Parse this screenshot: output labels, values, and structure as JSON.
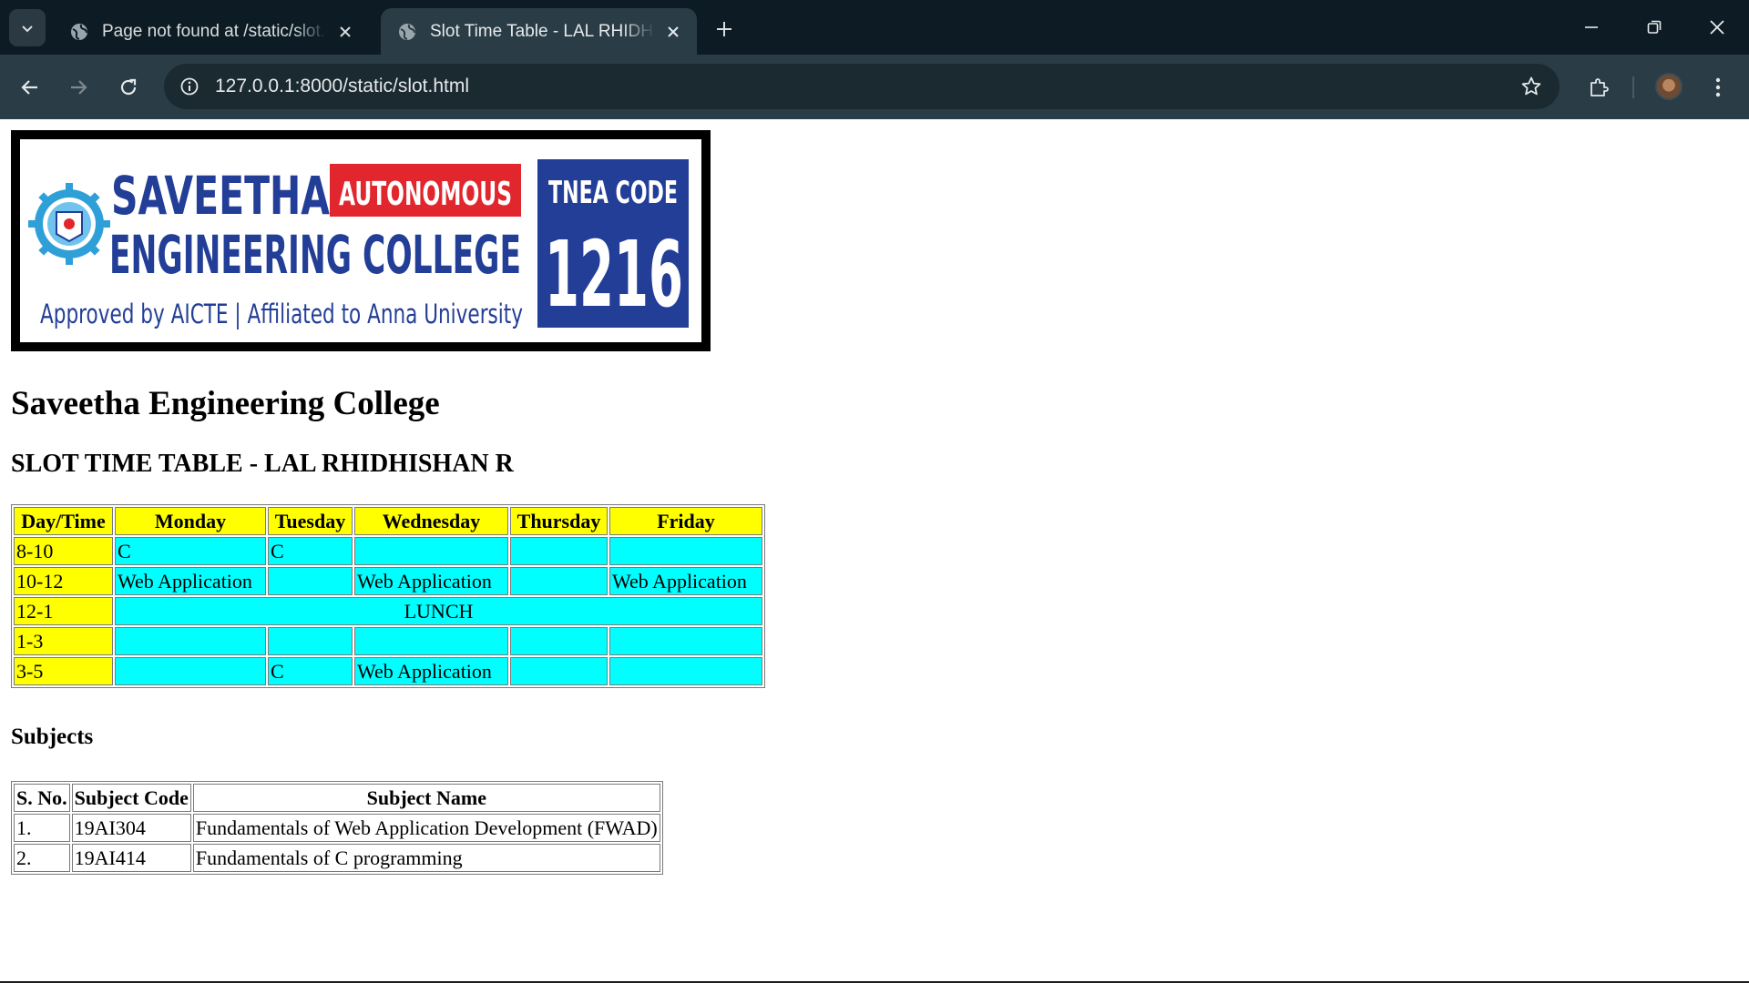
{
  "browser": {
    "tabs": [
      {
        "title": "Page not found at /static/slot.html",
        "active": false
      },
      {
        "title": "Slot Time Table - LAL RHIDHISHAN R",
        "active": true
      }
    ],
    "url": "127.0.0.1:8000/static/slot.html"
  },
  "banner": {
    "line1": "SAVEETHA",
    "badge": "AUTONOMOUS",
    "line2": "ENGINEERING COLLEGE",
    "line3": "Approved by AICTE | Affiliated to Anna University",
    "tnea_label": "TNEA CODE",
    "tnea_code": "1216",
    "colors": {
      "blue": "#233e97",
      "red": "#e1262d"
    }
  },
  "page": {
    "heading": "Saveetha Engineering College",
    "subheading": "SLOT TIME TABLE - LAL RHIDHISHAN R",
    "subjects_heading": "Subjects"
  },
  "timetable": {
    "headers": [
      "Day/Time",
      "Monday",
      "Tuesday",
      "Wednesday",
      "Thursday",
      "Friday"
    ],
    "rows": [
      {
        "time": "8-10",
        "cells": [
          "C",
          "C",
          "",
          "",
          ""
        ]
      },
      {
        "time": "10-12",
        "cells": [
          "Web Application",
          "",
          "Web Application",
          "",
          "Web Application"
        ]
      },
      {
        "time": "12-1",
        "lunch": "LUNCH"
      },
      {
        "time": "1-3",
        "cells": [
          "",
          "",
          "",
          "",
          ""
        ]
      },
      {
        "time": "3-5",
        "cells": [
          "",
          "C",
          "Web Application",
          "",
          ""
        ]
      }
    ],
    "colors": {
      "header": "#ffff00",
      "cell": "#00ffff"
    }
  },
  "subjects": {
    "headers": [
      "S. No.",
      "Subject Code",
      "Subject Name"
    ],
    "rows": [
      [
        "1.",
        "19AI304",
        "Fundamentals of Web Application Development (FWAD)"
      ],
      [
        "2.",
        "19AI414",
        "Fundamentals of C programming"
      ]
    ]
  }
}
